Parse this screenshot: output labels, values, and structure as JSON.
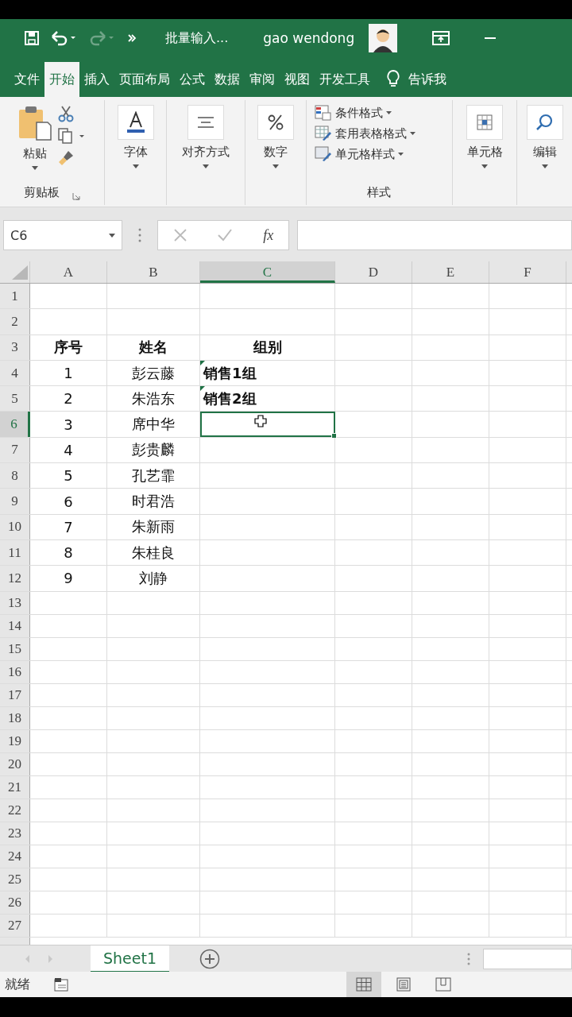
{
  "title_bar": {
    "document_title": "批量输入...",
    "user": "gao wendong",
    "redo_disabled": true
  },
  "ribbon_tabs": [
    {
      "label": "文件",
      "selected": false
    },
    {
      "label": "开始",
      "selected": true
    },
    {
      "label": "插入",
      "selected": false
    },
    {
      "label": "页面布局",
      "selected": false
    },
    {
      "label": "公式",
      "selected": false
    },
    {
      "label": "数据",
      "selected": false
    },
    {
      "label": "审阅",
      "selected": false
    },
    {
      "label": "视图",
      "selected": false
    },
    {
      "label": "开发工具",
      "selected": false
    }
  ],
  "tell_me": "告诉我",
  "ribbon": {
    "clipboard": {
      "paste": "粘贴",
      "label": "剪贴板"
    },
    "big_buttons": [
      {
        "kind": "font",
        "label": "字体"
      },
      {
        "kind": "align",
        "label": "对齐方式"
      },
      {
        "kind": "number",
        "label": "数字"
      }
    ],
    "styles": {
      "items": [
        {
          "kind": "conditional",
          "label": "条件格式"
        },
        {
          "kind": "table",
          "label": "套用表格格式"
        },
        {
          "kind": "cellstyle",
          "label": "单元格样式"
        }
      ],
      "label": "样式"
    },
    "cells_button": "单元格",
    "edit_button": "编辑"
  },
  "formula_bar": {
    "name_box": "C6",
    "fx": "fx"
  },
  "columns": [
    {
      "label": "A",
      "selected": false
    },
    {
      "label": "B",
      "selected": false
    },
    {
      "label": "C",
      "selected": true
    },
    {
      "label": "D",
      "selected": false
    },
    {
      "label": "E",
      "selected": false
    },
    {
      "label": "F",
      "selected": false
    }
  ],
  "rows": [
    {
      "header": "1",
      "selected": false
    },
    {
      "header": "2",
      "selected": false
    },
    {
      "header": "3",
      "selected": false,
      "cells": [
        {
          "text": "序号",
          "bold": true,
          "selected": false
        },
        {
          "text": "姓名",
          "bold": true,
          "selected": false
        },
        {
          "text": "组别",
          "bold": true,
          "selected": false
        }
      ]
    },
    {
      "header": "4",
      "selected": false,
      "cells": [
        {
          "text": "1",
          "selected": false
        },
        {
          "text": "彭云藤",
          "selected": false
        },
        {
          "text": "销售1组",
          "bold": true,
          "flag": true,
          "selected": false
        }
      ]
    },
    {
      "header": "5",
      "selected": false,
      "cells": [
        {
          "text": "2",
          "selected": false
        },
        {
          "text": "朱浩东",
          "selected": false
        },
        {
          "text": "销售2组",
          "bold": true,
          "flag": true,
          "selected": false
        }
      ]
    },
    {
      "header": "6",
      "selected": true,
      "cells": [
        {
          "text": "3",
          "selected": false
        },
        {
          "text": "席中华",
          "selected": false
        },
        {
          "selected": true
        }
      ]
    },
    {
      "header": "7",
      "selected": false,
      "cells": [
        {
          "text": "4",
          "selected": false
        },
        {
          "text": "彭贵麟",
          "selected": false
        }
      ]
    },
    {
      "header": "8",
      "selected": false,
      "cells": [
        {
          "text": "5",
          "selected": false
        },
        {
          "text": "孔艺霏",
          "selected": false
        }
      ]
    },
    {
      "header": "9",
      "selected": false,
      "cells": [
        {
          "text": "6",
          "selected": false
        },
        {
          "text": "时君浩",
          "selected": false
        }
      ]
    },
    {
      "header": "10",
      "selected": false,
      "cells": [
        {
          "text": "7",
          "selected": false
        },
        {
          "text": "朱新雨",
          "selected": false
        }
      ]
    },
    {
      "header": "11",
      "selected": false,
      "cells": [
        {
          "text": "8",
          "selected": false
        },
        {
          "text": "朱桂良",
          "selected": false
        }
      ]
    },
    {
      "header": "12",
      "selected": false,
      "cells": [
        {
          "text": "9",
          "selected": false
        },
        {
          "text": "刘静",
          "selected": false
        }
      ]
    },
    {
      "header": "13",
      "selected": false
    },
    {
      "header": "14",
      "selected": false
    },
    {
      "header": "15",
      "selected": false
    },
    {
      "header": "16",
      "selected": false
    },
    {
      "header": "17",
      "selected": false
    },
    {
      "header": "18",
      "selected": false
    },
    {
      "header": "19",
      "selected": false
    },
    {
      "header": "20",
      "selected": false
    },
    {
      "header": "21",
      "selected": false
    },
    {
      "header": "22",
      "selected": false
    },
    {
      "header": "23",
      "selected": false
    },
    {
      "header": "24",
      "selected": false
    },
    {
      "header": "25",
      "selected": false
    },
    {
      "header": "26",
      "selected": false
    },
    {
      "header": "27",
      "selected": false
    }
  ],
  "sheet_tabs": [
    {
      "label": "Sheet1",
      "selected": true
    }
  ],
  "status_bar": {
    "status": "就绪",
    "views": [
      {
        "kind": "normal",
        "selected": true
      },
      {
        "kind": "layout",
        "selected": false
      },
      {
        "kind": "break",
        "selected": false
      }
    ]
  }
}
